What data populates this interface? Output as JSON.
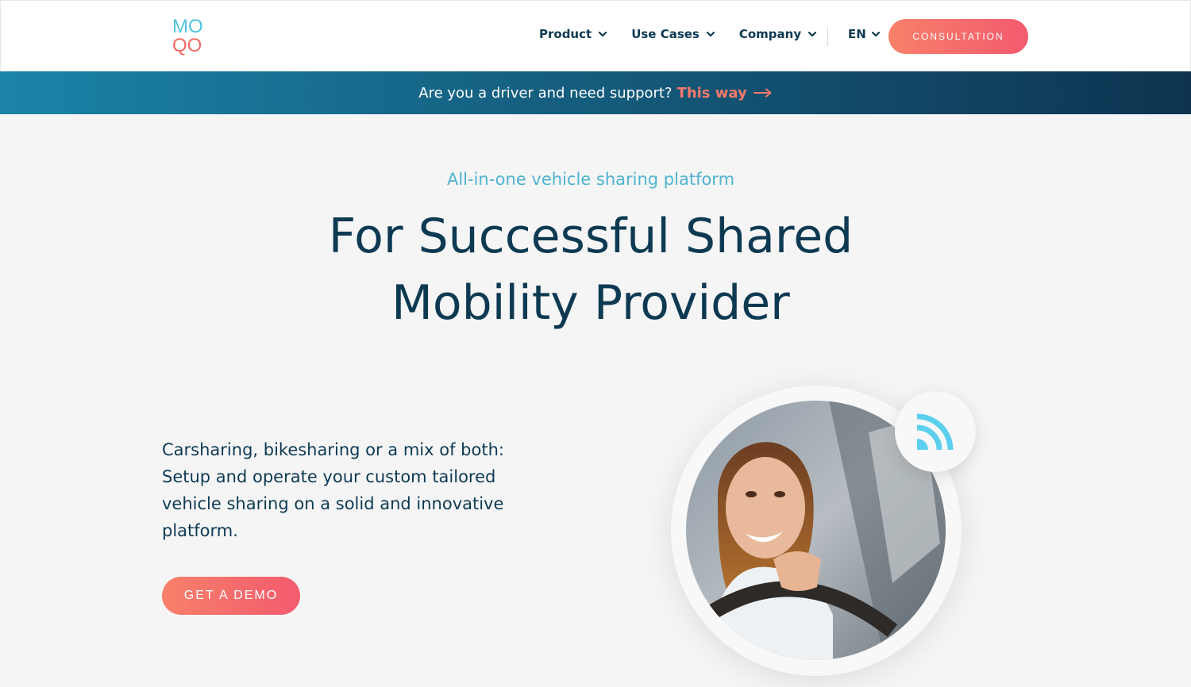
{
  "header": {
    "logo": {
      "line1": "MO",
      "line2": "QO"
    },
    "nav": [
      {
        "label": "Product"
      },
      {
        "label": "Use Cases"
      },
      {
        "label": "Company"
      }
    ],
    "language": "EN",
    "cta_label": "CONSULTATION"
  },
  "banner": {
    "text": "Are you a driver and need support?",
    "link_label": "This way"
  },
  "hero": {
    "kicker": "All-in-one vehicle sharing platform",
    "headline_line1": "For Successful Shared",
    "headline_line2": "Mobility Provider",
    "description": "Carsharing, bikesharing or a mix of both: Setup and operate your custom tailored vehicle sharing on a solid and innovative platform.",
    "cta_label": "GET A DEMO"
  },
  "colors": {
    "primary_text": "#0d3a52",
    "accent_coral": "#f46a67",
    "accent_cyan": "#4fc3dd"
  },
  "icons": {
    "nav_chevron": "chevron-down-icon",
    "banner_arrow": "arrow-right-icon",
    "badge": "wireless-signal-icon"
  }
}
